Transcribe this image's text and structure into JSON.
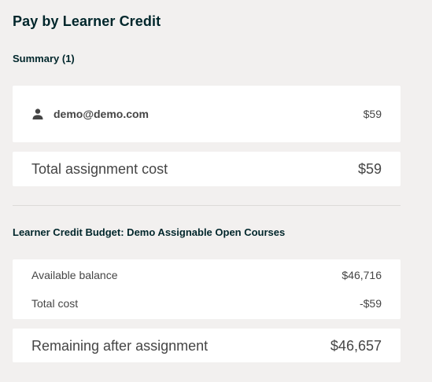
{
  "page": {
    "title": "Pay by Learner Credit"
  },
  "summary": {
    "heading": "Summary (1)",
    "learners": [
      {
        "email": "demo@demo.com",
        "price": "$59",
        "icon": "person-icon"
      }
    ],
    "total_label": "Total assignment cost",
    "total_value": "$59"
  },
  "budget": {
    "heading": "Learner Credit Budget: Demo Assignable Open Courses",
    "available_label": "Available balance",
    "available_value": "$46,716",
    "cost_label": "Total cost",
    "cost_value": "-$59",
    "remaining_label": "Remaining after assignment",
    "remaining_value": "$46,657"
  },
  "colors": {
    "background": "#f2f0ef",
    "card": "#ffffff",
    "heading_text": "#00262b",
    "body_text": "#454545",
    "divider": "#dcdad8"
  }
}
